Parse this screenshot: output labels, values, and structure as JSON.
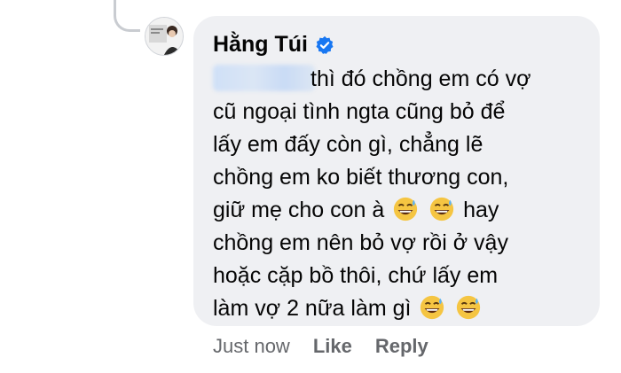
{
  "comment": {
    "author": "Hằng Túi",
    "lines": [
      "thì đó chồng em có vợ",
      "cũ ngoại tình ngta cũng bỏ để",
      "lấy em đấy còn gì, chẳng lẽ",
      "chồng em ko biết thương con,",
      "giữ mẹ cho con à",
      "hay",
      "chồng em nên bỏ vợ rồi ở vậy",
      "hoặc cặp bồ thôi, chứ lấy em",
      "làm vợ 2 nữa làm gì"
    ],
    "emoji": "grinning-face-with-sweat"
  },
  "actions": {
    "timestamp": "Just now",
    "like": "Like",
    "reply": "Reply"
  },
  "colors": {
    "bubble": "#eff0f3",
    "meta": "#65676b",
    "verified": "#1877f2"
  }
}
